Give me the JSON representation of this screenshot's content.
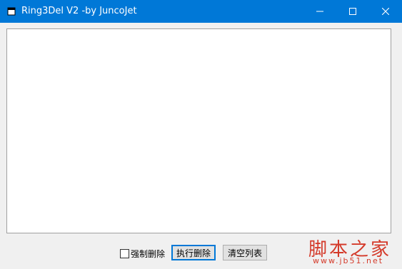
{
  "window": {
    "title": "Ring3Del V2 -by JuncoJet",
    "accent_color": "#0078d7"
  },
  "listbox": {
    "items": []
  },
  "controls": {
    "force_delete_label": "强制删除",
    "force_delete_checked": false,
    "execute_delete_label": "执行删除",
    "clear_list_label": "清空列表"
  },
  "watermark": {
    "brand": "脚本之家",
    "url": "www.jb51.net"
  },
  "icons": {
    "app": "app-icon",
    "minimize": "minimize-icon",
    "maximize": "maximize-icon",
    "close": "close-icon"
  }
}
